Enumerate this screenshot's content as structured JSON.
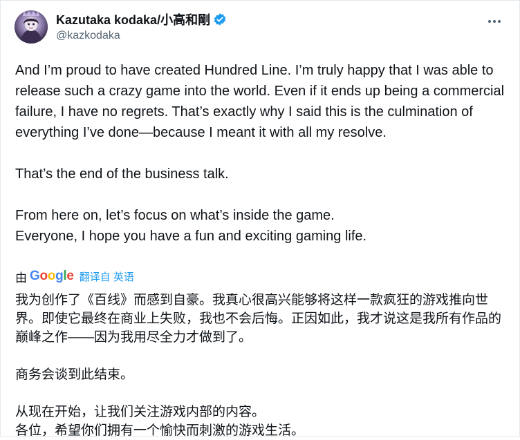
{
  "author": {
    "display_name": "Kazutaka kodaka/小高和剛",
    "handle": "@kazkodaka",
    "verified": true,
    "avatar_icon": "avatar-image",
    "verified_color": "#1d9bf0"
  },
  "menu": {
    "icon": "more-horizontal-icon"
  },
  "tweet": {
    "paragraphs": [
      "And I’m proud to have created Hundred Line. I’m truly happy that I was able to release such a crazy game into the world. Even if it ends up being a commercial failure, I have no regrets. That’s exactly why I said this is the culmination of everything I’ve done—because I meant it with all my resolve.",
      "That’s the end of the business talk.",
      "From here on, let’s focus on what’s inside the game.\nEveryone, I hope you have a fun and exciting gaming life."
    ]
  },
  "translation": {
    "by_label": "由",
    "provider": "Google",
    "link_label": "翻译自 英语",
    "paragraphs": [
      "我为创作了《百线》而感到自豪。我真心很高兴能够将这样一款疯狂的游戏推向世界。即使它最终在商业上失败，我也不会后悔。正因如此，我才说这是我所有作品的巅峰之作——因为我用尽全力才做到了。",
      "商务会谈到此结束。",
      "从现在开始，让我们关注游戏内部的内容。\n各位，希望你们拥有一个愉快而刺激的游戏生活。"
    ]
  },
  "colors": {
    "text": "#0f1419",
    "secondary_text": "#536471",
    "link": "#1d9bf0",
    "border": "#e1e8ed"
  }
}
